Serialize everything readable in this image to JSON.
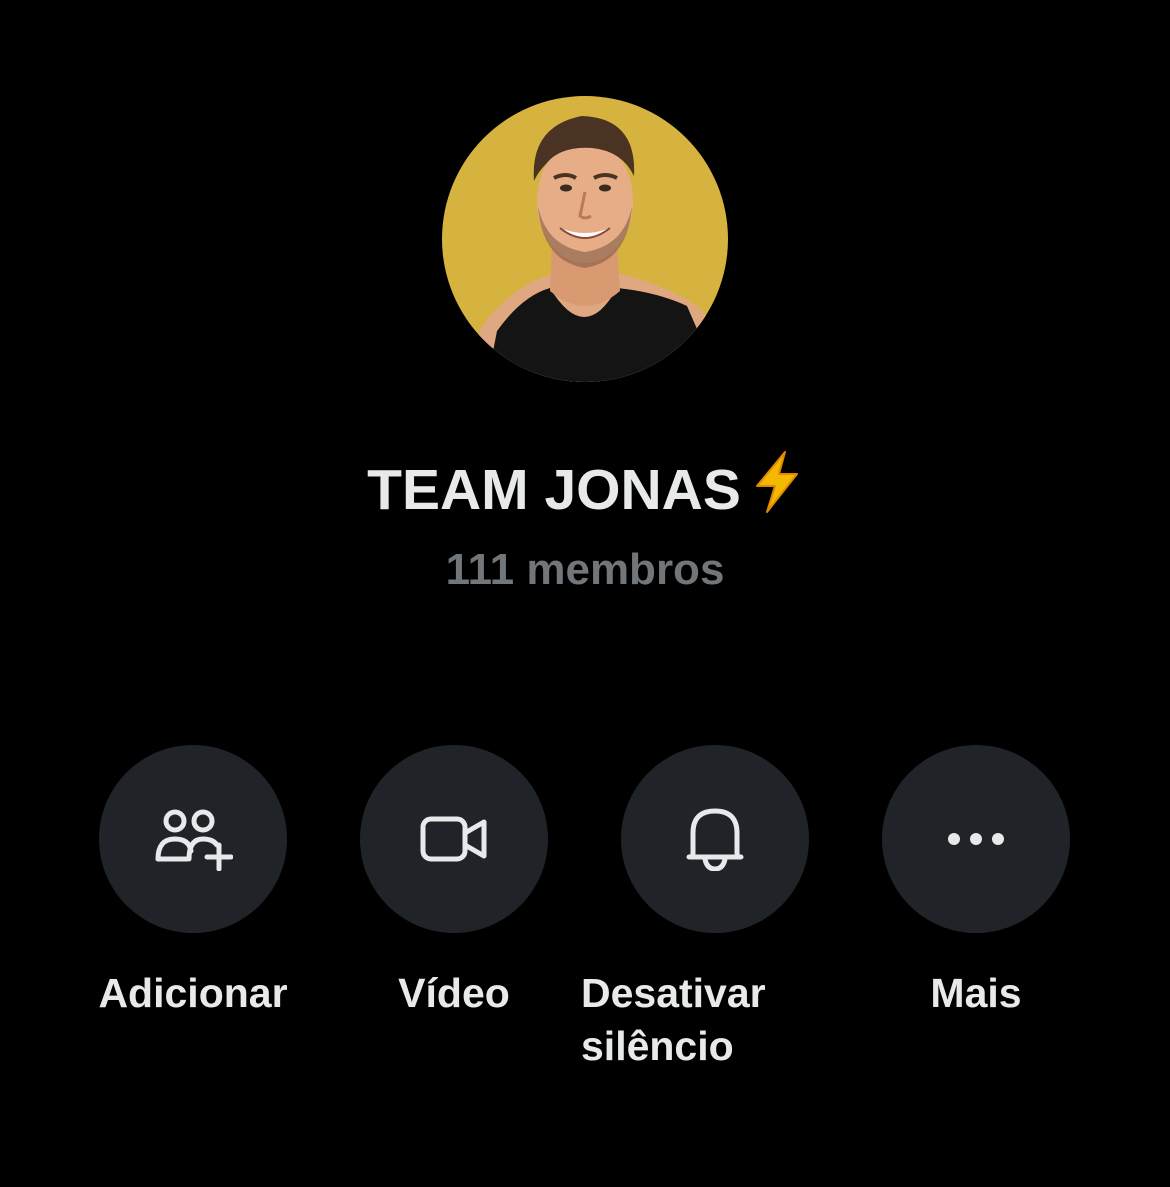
{
  "group": {
    "name": "TEAM JONAS",
    "emoji": "⚡",
    "members": "111 membros"
  },
  "actions": [
    {
      "id": "add",
      "label": "Adicionar",
      "icon": "add-people-icon"
    },
    {
      "id": "video",
      "label": "Vídeo",
      "icon": "video-camera-icon"
    },
    {
      "id": "unmute",
      "label": "Desativar\nsilêncio",
      "icon": "bell-icon"
    },
    {
      "id": "more",
      "label": "Mais",
      "icon": "more-dots-icon"
    }
  ],
  "colors": {
    "background": "#000000",
    "primary_text": "#e7e9ea",
    "secondary_text": "#71767b",
    "button_bg": "#202327",
    "avatar_bg": "#d6b23f",
    "bolt": "#f5b800"
  }
}
